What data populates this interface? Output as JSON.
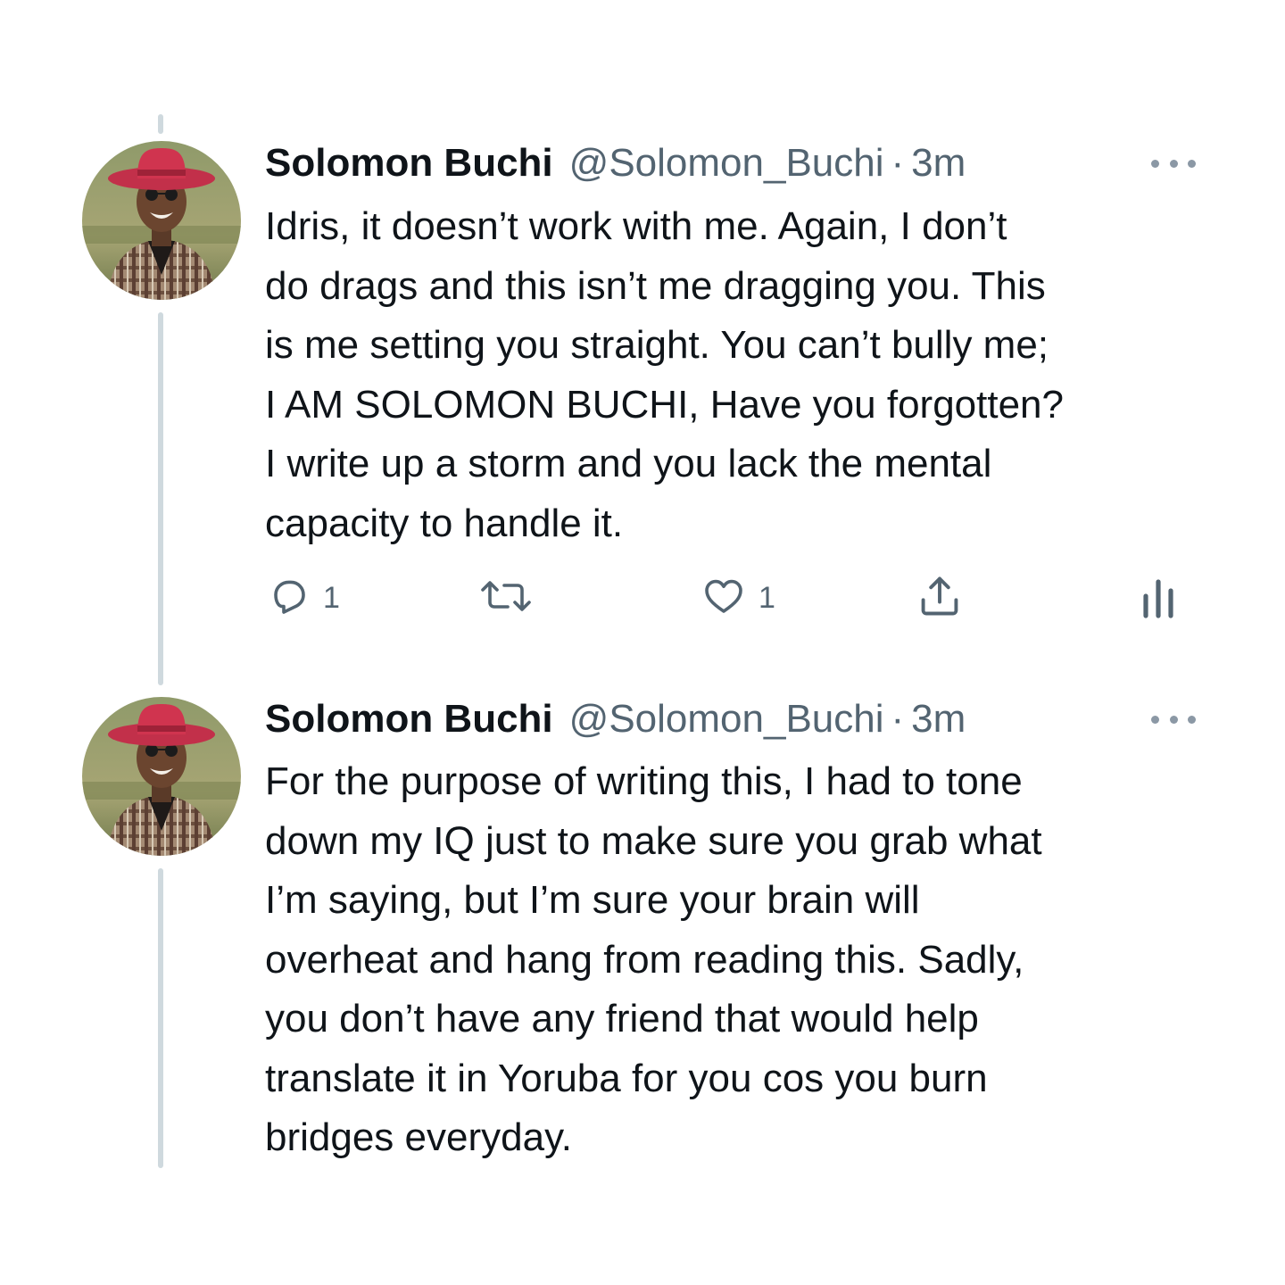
{
  "tweets": [
    {
      "author": {
        "name": "Solomon Buchi",
        "handle": "@Solomon_Buchi"
      },
      "separator": "·",
      "time": "3m",
      "text_lines": [
        "Idris, it doesn’t work with me. Again, I don’t",
        "do drags and this isn’t me dragging you. This",
        "is me setting you straight. You can’t bully me;",
        "I AM SOLOMON BUCHI, Have you forgotten?",
        "I write up a storm and you lack the mental",
        "capacity to handle it."
      ],
      "actions": {
        "reply_count": "1",
        "retweet_count": "",
        "like_count": "1"
      }
    },
    {
      "author": {
        "name": "Solomon Buchi",
        "handle": "@Solomon_Buchi"
      },
      "separator": "·",
      "time": "3m",
      "text_lines": [
        "For the purpose of writing this, I had to tone",
        "down my IQ just to make sure you grab what",
        "I’m saying, but I’m sure your brain will",
        "overheat and hang from reading this. Sadly,",
        "you don’t have any friend that would help",
        "translate it in Yoruba for you cos you burn",
        "bridges everyday."
      ]
    }
  ],
  "icons": {
    "more": "more-horizontal-icon",
    "reply": "reply-icon",
    "retweet": "retweet-icon",
    "like": "heart-icon",
    "share": "share-icon",
    "analytics": "analytics-icon"
  },
  "colors": {
    "text": "#0f1419",
    "secondary": "#536471",
    "thread_line": "#cfd9de",
    "avatar_hat": "#d0344f"
  }
}
